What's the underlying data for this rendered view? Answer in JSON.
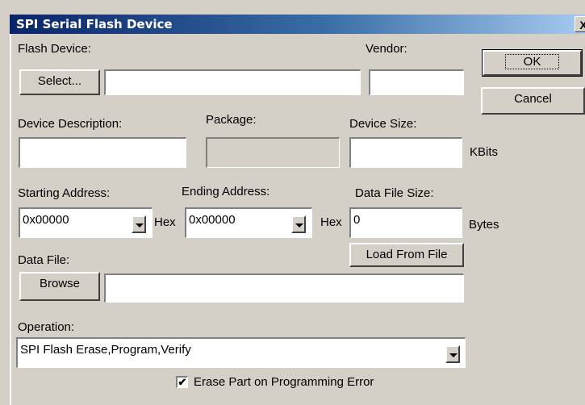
{
  "window": {
    "title": "SPI Serial Flash Device",
    "close_label": "X"
  },
  "flash_device": {
    "label": "Flash Device:",
    "select_button": "Select...",
    "value": ""
  },
  "vendor": {
    "label": "Vendor:",
    "value": ""
  },
  "ok_button": "OK",
  "cancel_button": "Cancel",
  "device_description": {
    "label": "Device Description:",
    "value": ""
  },
  "package": {
    "label": "Package:",
    "value": ""
  },
  "device_size": {
    "label": "Device Size:",
    "value": "",
    "unit": "KBits"
  },
  "starting_address": {
    "label": "Starting Address:",
    "value": "0x00000",
    "suffix": "Hex"
  },
  "ending_address": {
    "label": "Ending Address:",
    "value": "0x00000",
    "suffix": "Hex"
  },
  "data_file_size": {
    "label": "Data File Size:",
    "value": "0",
    "unit": "Bytes"
  },
  "load_from_file_button": "Load From File",
  "data_file": {
    "label": "Data File:",
    "browse_button": "Browse",
    "value": ""
  },
  "operation": {
    "label": "Operation:",
    "value": "SPI Flash Erase,Program,Verify"
  },
  "erase_checkbox": {
    "label": "Erase Part on Programming Error",
    "checked": true,
    "mark": "✔"
  }
}
